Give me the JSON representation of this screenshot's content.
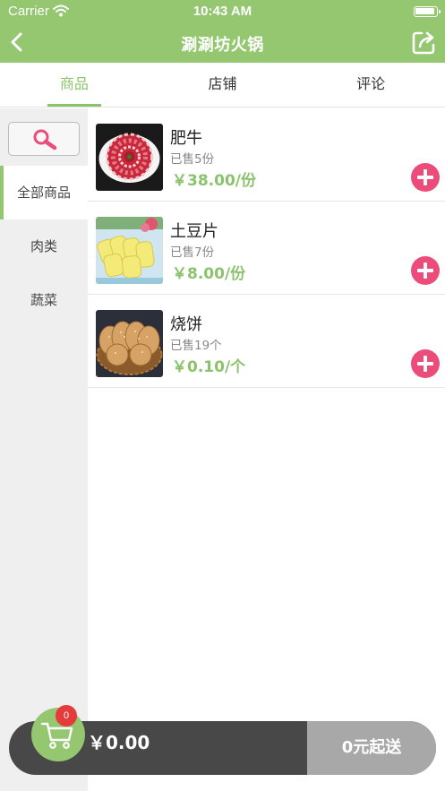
{
  "status_bar": {
    "carrier": "Carrier",
    "time": "10:43 AM"
  },
  "nav": {
    "title": "涮涮坊火锅",
    "back_icon": "chevron-left-icon",
    "share_icon": "share-external-icon"
  },
  "tabs": [
    {
      "label": "商品",
      "active": true
    },
    {
      "label": "店铺",
      "active": false
    },
    {
      "label": "评论",
      "active": false
    }
  ],
  "sidebar": {
    "search_icon": "search-icon",
    "categories": [
      {
        "label": "全部商品",
        "active": true
      },
      {
        "label": "肉类",
        "active": false
      },
      {
        "label": "蔬菜",
        "active": false
      }
    ]
  },
  "products": [
    {
      "name": "肥牛",
      "sold": "已售5份",
      "price": "￥38.00/份",
      "image": "sliced-beef-plate"
    },
    {
      "name": "土豆片",
      "sold": "已售7份",
      "price": "￥8.00/份",
      "image": "potato-slices"
    },
    {
      "name": "烧饼",
      "sold": "已售19个",
      "price": "￥0.10/个",
      "image": "sesame-flatbread-basket"
    }
  ],
  "cart": {
    "count": "0",
    "total": "￥0.00",
    "checkout_label": "0元起送"
  },
  "colors": {
    "brand_green": "#94c770",
    "accent_green": "#8bc36c",
    "add_button_pink": "#ec4c7a",
    "badge_red": "#e53b3b",
    "cart_bar_dark": "#484848",
    "checkout_gray": "#a8a8a8"
  }
}
